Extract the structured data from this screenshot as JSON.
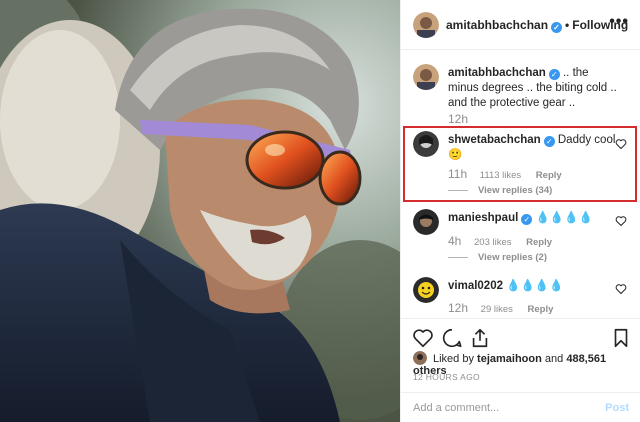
{
  "post": {
    "owner": "amitabhbachchan",
    "follow_state": "Following",
    "separator": "•",
    "more_label": "•••",
    "caption": {
      "user": "amitabhbachchan",
      "text": ".. the minus degrees .. the biting cold .. and the protective gear ..",
      "time": "12h"
    },
    "comments": [
      {
        "user": "shwetabachchan",
        "verified": true,
        "text": "Daddy cool 🙂",
        "time": "11h",
        "likes": "1113 likes",
        "reply": "Reply",
        "view_replies": "View replies (34)",
        "highlighted": true
      },
      {
        "user": "manieshpaul",
        "verified": true,
        "text": "💧💧💧💧",
        "time": "4h",
        "likes": "203 likes",
        "reply": "Reply",
        "view_replies": "View replies (2)",
        "highlighted": false
      },
      {
        "user": "vimal0202",
        "verified": false,
        "text": "💧💧💧💧",
        "time": "12h",
        "likes": "29 likes",
        "reply": "Reply",
        "view_replies": "",
        "highlighted": false
      }
    ],
    "liked_by": {
      "prefix": "Liked by",
      "user": "tejamaihoon",
      "connector": "and",
      "others": "488,561 others"
    },
    "timestamp": "12 HOURS AGO",
    "add_comment": {
      "placeholder": "Add a comment...",
      "post_label": "Post"
    },
    "icons": [
      "heart-icon",
      "comment-icon",
      "share-icon",
      "bookmark-icon",
      "more-icon",
      "verified-icon"
    ],
    "colors": {
      "verified": "#3897f0",
      "highlight_border": "#d52d2d",
      "muted": "#8e8e8e",
      "post_disabled": "#b3dbff"
    }
  }
}
